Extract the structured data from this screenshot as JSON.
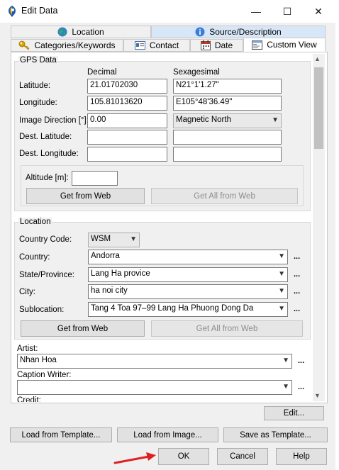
{
  "window": {
    "title": "Edit Data",
    "minimize": "—",
    "maximize": "☐",
    "close": "✕"
  },
  "tabs": {
    "row1": [
      {
        "label": "Location",
        "icon": "globe-icon"
      },
      {
        "label": "Source/Description",
        "icon": "info-icon"
      }
    ],
    "row2": [
      {
        "label": "Categories/Keywords",
        "icon": "key-icon"
      },
      {
        "label": "Contact",
        "icon": "contact-card-icon"
      },
      {
        "label": "Date",
        "icon": "calendar-icon"
      },
      {
        "label": "Custom View",
        "icon": "window-icon"
      }
    ],
    "active": "Custom View"
  },
  "gps": {
    "legend": "GPS Data",
    "decimal_header": "Decimal",
    "sexagesimal_header": "Sexagesimal",
    "latitude_label": "Latitude:",
    "latitude_decimal": "21.01702030",
    "latitude_sexagesimal": "N21°1'1.27\"",
    "longitude_label": "Longitude:",
    "longitude_decimal": "105.81013620",
    "longitude_sexagesimal": "E105°48'36.49\"",
    "direction_label": "Image Direction [°]:",
    "direction_value": "0.00",
    "direction_ref": "Magnetic North",
    "dest_lat_label": "Dest. Latitude:",
    "dest_lon_label": "Dest. Longitude:",
    "altitude_label": "Altitude [m]:",
    "altitude_value": "",
    "get_from_web": "Get from Web",
    "get_all_from_web": "Get All from Web"
  },
  "location": {
    "legend": "Location",
    "country_code_label": "Country Code:",
    "country_code": "WSM",
    "country_label": "Country:",
    "country": "Andorra",
    "state_label": "State/Province:",
    "state": "Lang Ha provice",
    "city_label": "City:",
    "city": "ha noi city",
    "sublocation_label": "Sublocation:",
    "sublocation": "Tang 4 Toa 97–99 Lang Ha Phuong Dong Da",
    "get_from_web": "Get from Web",
    "get_all_from_web": "Get All from Web",
    "more": "..."
  },
  "artist": {
    "label": "Artist:",
    "value": "Nhan Hoa"
  },
  "caption_writer": {
    "label": "Caption Writer:",
    "value": ""
  },
  "credit": {
    "label": "Credit:"
  },
  "buttons": {
    "edit": "Edit...",
    "load_template": "Load from Template...",
    "load_image": "Load from Image...",
    "save_template": "Save as Template...",
    "ok": "OK",
    "cancel": "Cancel",
    "help": "Help"
  },
  "colors": {
    "accent_tab": "#d8e7f7",
    "arrow": "#e02020"
  }
}
